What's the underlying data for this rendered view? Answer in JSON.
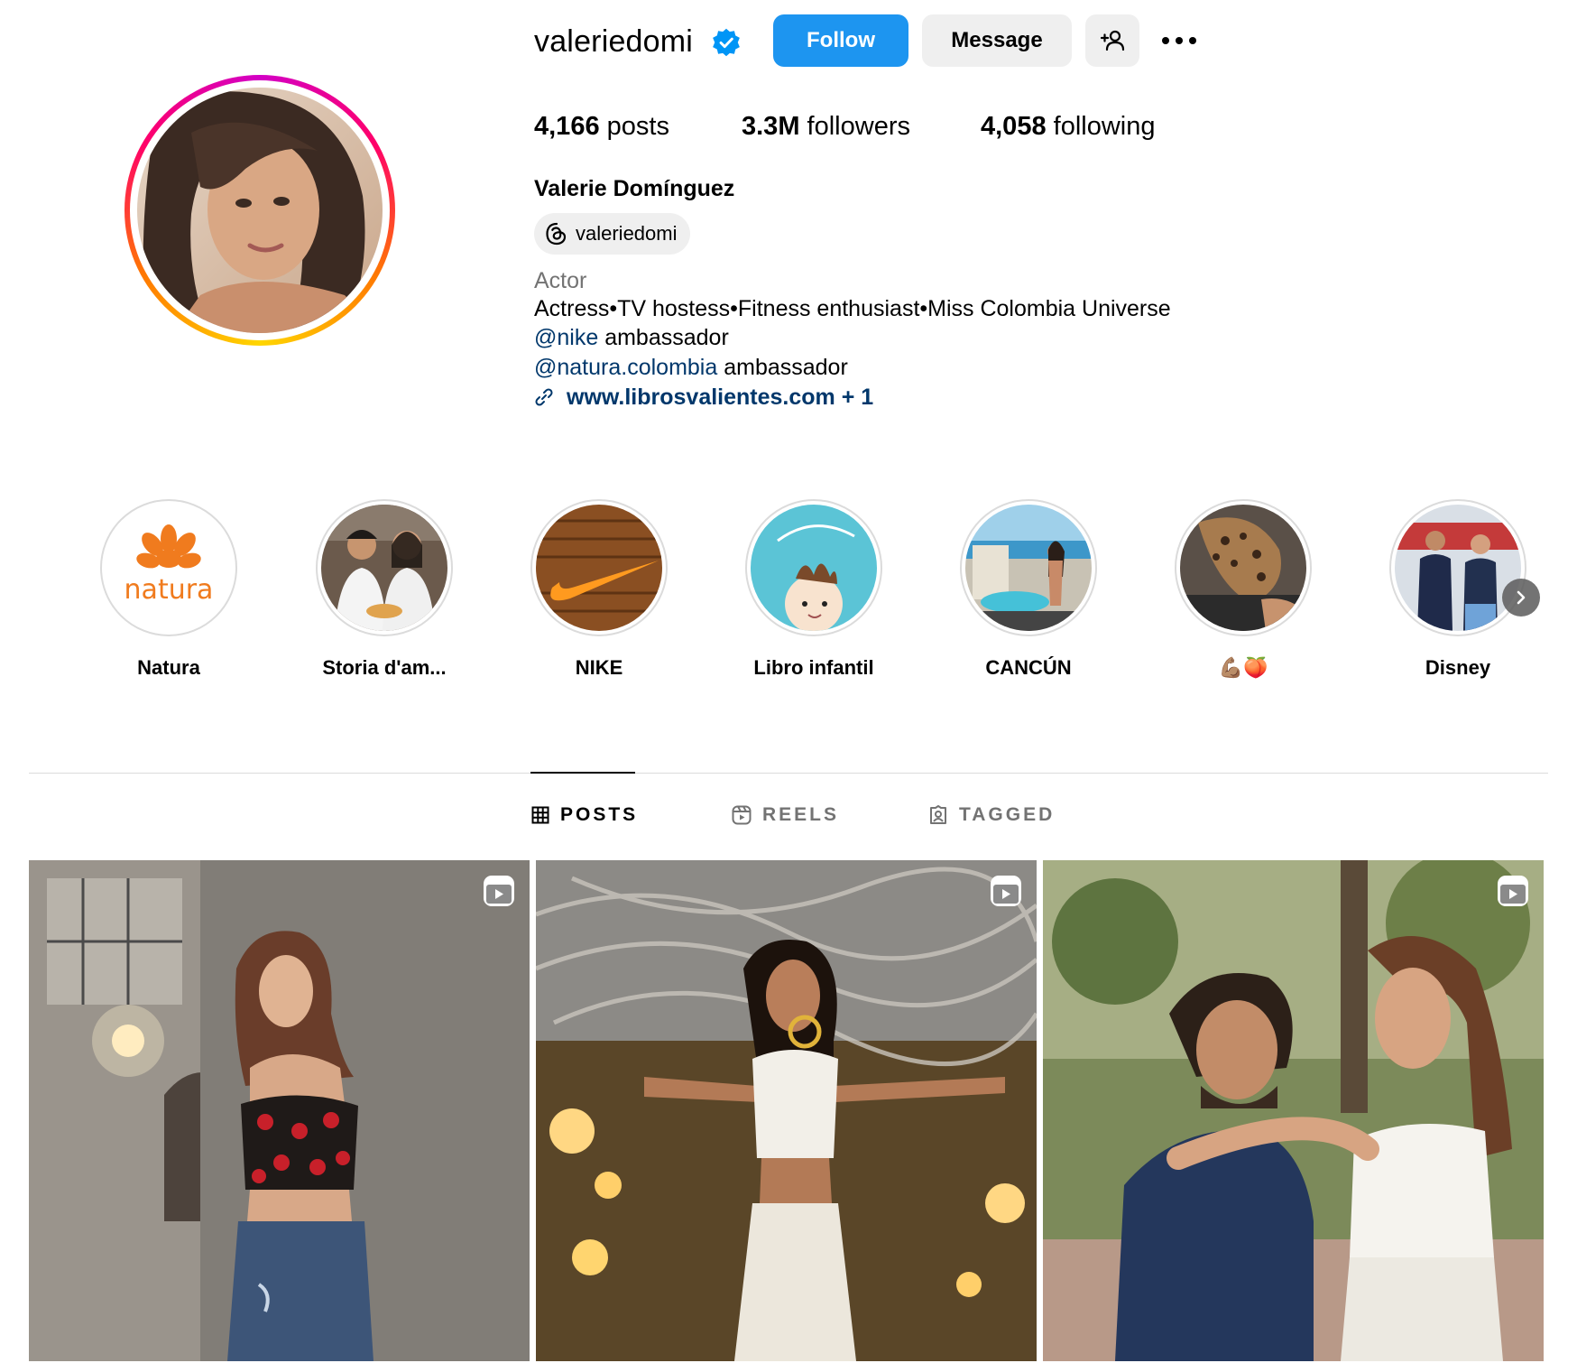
{
  "profile": {
    "username": "valeriedomi",
    "verified": true,
    "follow_label": "Follow",
    "message_label": "Message",
    "stats": {
      "posts_count": "4,166",
      "posts_label": "posts",
      "followers_count": "3.3M",
      "followers_label": "followers",
      "following_count": "4,058",
      "following_label": "following"
    },
    "full_name": "Valerie Domínguez",
    "threads_handle": "valeriedomi",
    "category": "Actor",
    "bio_line1": "Actress•TV hostess•Fitness enthusiast•Miss Colombia Universe",
    "bio_line2_mention": "@nike",
    "bio_line2_text": " ambassador",
    "bio_line3_mention": "@natura.colombia",
    "bio_line3_text": " ambassador",
    "link": "www.librosvalientes.com + 1"
  },
  "highlights": [
    {
      "label": "Natura",
      "icon": "natura-logo"
    },
    {
      "label": "Storia d'am...",
      "icon": "chef-couple-photo"
    },
    {
      "label": "NIKE",
      "icon": "nike-swoosh"
    },
    {
      "label": "Libro infantil",
      "icon": "childrens-book-cover"
    },
    {
      "label": "CANCÚN",
      "icon": "resort-photo"
    },
    {
      "label": "💪🏽🍑",
      "icon": "workout-photo"
    },
    {
      "label": "Disney",
      "icon": "disney-photo"
    }
  ],
  "natura_text": "natura",
  "tabs": [
    {
      "label": "POSTS",
      "icon": "grid-icon",
      "active": true
    },
    {
      "label": "REELS",
      "icon": "reels-icon",
      "active": false
    },
    {
      "label": "TAGGED",
      "icon": "tagged-icon",
      "active": false
    }
  ],
  "posts": [
    {
      "type": "reel",
      "description": "woman in cherry top and jeans"
    },
    {
      "type": "reel",
      "description": "woman in white outfit with golden lights"
    },
    {
      "type": "reel",
      "description": "couple embracing in park"
    }
  ],
  "colors": {
    "follow_blue": "#1d95f0",
    "link_blue": "#00376b",
    "button_gray": "#efefef",
    "muted_text": "#737373",
    "verified_blue": "#0095f6"
  }
}
